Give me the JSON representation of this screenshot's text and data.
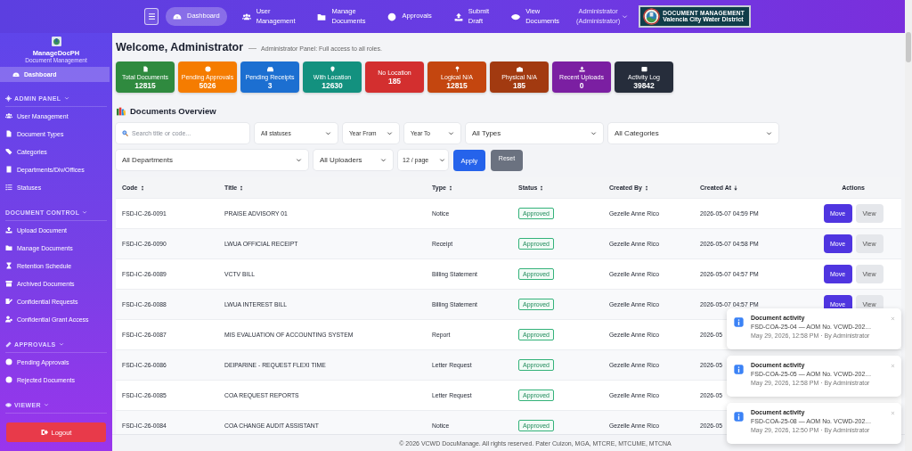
{
  "topnav": {
    "items": [
      {
        "label": "Dashboard",
        "selected": true
      },
      {
        "label": "User Management",
        "selected": false
      },
      {
        "label": "Manage Documents",
        "selected": false
      },
      {
        "label": "Approvals",
        "selected": false
      },
      {
        "label": "Submit Draft",
        "selected": false
      },
      {
        "label": "View Documents",
        "selected": false
      }
    ],
    "user": "Administrator (Administrator)",
    "brand": {
      "title": "DOCUMENT MANAGEMENT",
      "subtitle": "Valencia City Water District"
    }
  },
  "sidebar": {
    "brand": {
      "name": "ManageDocPH",
      "subtitle": "Document Management"
    },
    "items": [
      {
        "label": "Dashboard",
        "selected": true
      }
    ],
    "sections": [
      {
        "title": "ADMIN PANEL",
        "items": [
          {
            "label": "User Management",
            "selected": false
          },
          {
            "label": "Document Types",
            "selected": false
          },
          {
            "label": "Categories",
            "selected": false
          },
          {
            "label": "Departments/Div/Offices",
            "selected": false
          },
          {
            "label": "Statuses",
            "selected": false
          }
        ]
      },
      {
        "title": "DOCUMENT CONTROL",
        "items": [
          {
            "label": "Upload Document",
            "selected": false
          },
          {
            "label": "Manage Documents",
            "selected": false
          },
          {
            "label": "Retention Schedule",
            "selected": false
          },
          {
            "label": "Archived Documents",
            "selected": false
          },
          {
            "label": "Confidential Requests",
            "selected": false
          },
          {
            "label": "Confidential Grant Access",
            "selected": false
          }
        ]
      },
      {
        "title": "APPROVALS",
        "items": [
          {
            "label": "Pending Approvals",
            "selected": false
          },
          {
            "label": "Rejected Documents",
            "selected": false
          }
        ]
      },
      {
        "title": "VIEWER"
      }
    ],
    "logout": "Logout"
  },
  "welcome": {
    "title": "Welcome, Administrator",
    "subtitle": "Administrator Panel: Full access to all roles."
  },
  "stats": [
    {
      "label": "Total Documents",
      "value": "12815",
      "color": "#2f8a3f"
    },
    {
      "label": "Pending Approvals",
      "value": "5026",
      "color": "#f57c00"
    },
    {
      "label": "Pending Receipts",
      "value": "3",
      "color": "#1c6fd1"
    },
    {
      "label": "With Location",
      "value": "12630",
      "color": "#13917f"
    },
    {
      "label": "No Location",
      "value": "185",
      "color": "#d32f2f"
    },
    {
      "label": "Logical N/A",
      "value": "12815",
      "color": "#c4460f"
    },
    {
      "label": "Physical N/A",
      "value": "185",
      "color": "#a23a10"
    },
    {
      "label": "Recent Uploads",
      "value": "0",
      "color": "#7b1fa2"
    },
    {
      "label": "Activity Log",
      "value": "39842",
      "color": "#262d3b"
    }
  ],
  "overview": {
    "title": "Documents Overview",
    "filters": [
      {
        "kind": "search",
        "placeholder": "Search title or code..."
      },
      {
        "kind": "select",
        "value": "All statuses"
      },
      {
        "kind": "select",
        "value": "Year From"
      },
      {
        "kind": "select",
        "value": "Year To"
      },
      {
        "kind": "select",
        "value": "All Types"
      },
      {
        "kind": "select",
        "value": "All Categories"
      },
      {
        "kind": "select",
        "value": "All Departments"
      },
      {
        "kind": "select",
        "value": "All Uploaders"
      },
      {
        "kind": "select",
        "value": "12 / page"
      },
      {
        "kind": "primary",
        "value": "Apply"
      },
      {
        "kind": "secondary",
        "value": "Reset"
      }
    ]
  },
  "table": {
    "columns": [
      {
        "label": "Code",
        "sortable": true,
        "sorted": false
      },
      {
        "label": "Title",
        "sortable": true,
        "sorted": false
      },
      {
        "label": "Type",
        "sortable": true,
        "sorted": false
      },
      {
        "label": "Status",
        "sortable": true,
        "sorted": false
      },
      {
        "label": "Created By",
        "sortable": true,
        "sorted": false
      },
      {
        "label": "Created At",
        "sortable": true,
        "sorted": true
      },
      {
        "label": "Actions",
        "sortable": false
      }
    ],
    "rows": [
      {
        "code": "FSD-IC-26-0091",
        "title": "PRAISE ADVISORY 01",
        "type": "Notice",
        "status": "Approved",
        "created_by": "Gezelle Anne Rico",
        "created_at": "2026-05-07 04:59 PM",
        "actions": [
          {
            "label": "Move",
            "kind": "primary"
          },
          {
            "label": "View",
            "kind": "secondary"
          }
        ]
      },
      {
        "code": "FSD-IC-26-0090",
        "title": "LWUA OFFICIAL RECEIPT",
        "type": "Receipt",
        "status": "Approved",
        "created_by": "Gezelle Anne Rico",
        "created_at": "2026-05-07 04:58 PM",
        "actions": [
          {
            "label": "Move",
            "kind": "primary"
          },
          {
            "label": "View",
            "kind": "secondary"
          }
        ]
      },
      {
        "code": "FSD-IC-26-0089",
        "title": "VCTV BILL",
        "type": "Billing Statement",
        "status": "Approved",
        "created_by": "Gezelle Anne Rico",
        "created_at": "2026-05-07 04:57 PM",
        "actions": [
          {
            "label": "Move",
            "kind": "primary"
          },
          {
            "label": "View",
            "kind": "secondary"
          }
        ]
      },
      {
        "code": "FSD-IC-26-0088",
        "title": "LWUA INTEREST BILL",
        "type": "Billing Statement",
        "status": "Approved",
        "created_by": "Gezelle Anne Rico",
        "created_at": "2026-05-07 04:57 PM",
        "actions": [
          {
            "label": "Move",
            "kind": "primary"
          },
          {
            "label": "View",
            "kind": "secondary"
          }
        ]
      },
      {
        "code": "FSD-IC-26-0087",
        "title": "MIS EVALUATION OF ACCOUNTING SYSTEM",
        "type": "Report",
        "status": "Approved",
        "created_by": "Gezelle Anne Rico",
        "created_at": "2026-05"
      },
      {
        "code": "FSD-IC-26-0086",
        "title": "DEIPARINE - REQUEST FLEXI TIME",
        "type": "Letter Request",
        "status": "Approved",
        "created_by": "Gezelle Anne Rico",
        "created_at": "2026-05"
      },
      {
        "code": "FSD-IC-26-0085",
        "title": "COA REQUEST REPORTS",
        "type": "Letter Request",
        "status": "Approved",
        "created_by": "Gezelle Anne Rico",
        "created_at": "2026-05"
      },
      {
        "code": "FSD-IC-26-0084",
        "title": "COA CHANGE AUDIT ASSISTANT",
        "type": "Notice",
        "status": "Approved",
        "created_by": "Gezelle Anne Rico",
        "created_at": "2026-05"
      }
    ]
  },
  "toasts": [
    {
      "title": "Document activity",
      "body": "FSD-COA-25-04 — AOM No. VCWD-202…",
      "meta": "May 29, 2026, 12:58 PM · By Administrator"
    },
    {
      "title": "Document activity",
      "body": "FSD-COA-25-05 — AOM No. VCWD-202…",
      "meta": "May 29, 2026, 12:58 PM · By Administrator"
    },
    {
      "title": "Document activity",
      "body": "FSD-COA-25-08 — AOM No. VCWD-202…",
      "meta": "May 29, 2026, 12:50 PM · By Administrator"
    }
  ],
  "footer": "© 2026 VCWD DocuManage. All rights reserved. Pater Cuizon, MGA, MTCRE, MTCUME, MTCNA"
}
